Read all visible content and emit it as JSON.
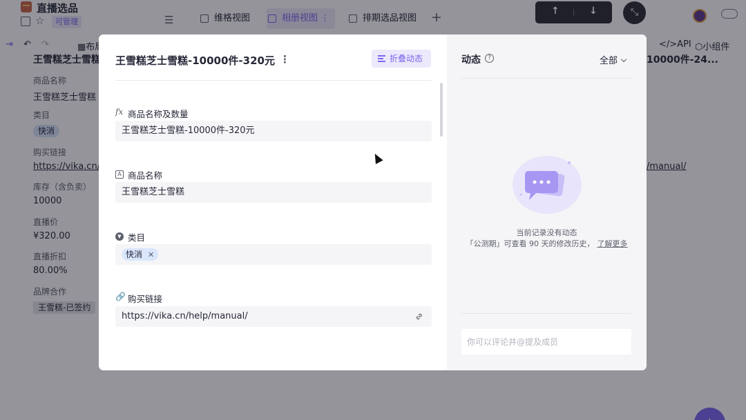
{
  "app": {
    "datasheet_title": "直播选品",
    "permission_badge": "可管理",
    "views": [
      "维格视图",
      "相册视图",
      "排期选品视图"
    ],
    "add_view": "+",
    "nav_up": "↑",
    "nav_down": "↓",
    "toolbar_layout_label": "布局",
    "toolbar_api_label": "API",
    "toolbar_widget_label": "小组件",
    "bg_title_left": "王雪糕芝士雪糕",
    "bg_title_right": "10000件-24...",
    "bg_link_right": "/manual/",
    "fab_label": "+"
  },
  "bg_card": {
    "fields": [
      {
        "label": "商品名称",
        "value": "王雪糕芝士雪糕"
      },
      {
        "label": "类目",
        "value": "快消"
      },
      {
        "label": "购买链接",
        "value": "https://vika.cn/h"
      },
      {
        "label": "库存（含负卖）",
        "value": "10000"
      },
      {
        "label": "直播价",
        "value": "¥320.00"
      },
      {
        "label": "直播折扣",
        "value": "80.00%"
      },
      {
        "label": "品牌合作",
        "value": "王雪糕-已签约"
      }
    ]
  },
  "record": {
    "title": "王雪糕芝士雪糕-10000件-320元",
    "fold_label": "折叠动态",
    "fields": [
      {
        "icon": "fx",
        "label": "商品名称及数量",
        "value": "王雪糕芝士雪糕-10000件-320元"
      },
      {
        "icon": "A",
        "label": "商品名称",
        "value": "王雪糕芝士雪糕"
      },
      {
        "icon": "select",
        "label": "类目",
        "value": "快消"
      },
      {
        "icon": "link",
        "label": "购买链接",
        "value": "https://vika.cn/help/manual/"
      }
    ]
  },
  "activity": {
    "title": "动态",
    "filter": "全部",
    "empty_line1": "当前记录没有动态",
    "empty_line2": "「公测期」可查看 90 天的修改历史，",
    "learn_more": "了解更多",
    "comment_placeholder": "你可以评论并@提及成员"
  },
  "colors": {
    "accent": "#7b67ee",
    "chip_blue": "#d9e6fc",
    "field_bg": "#f5f5f7"
  }
}
